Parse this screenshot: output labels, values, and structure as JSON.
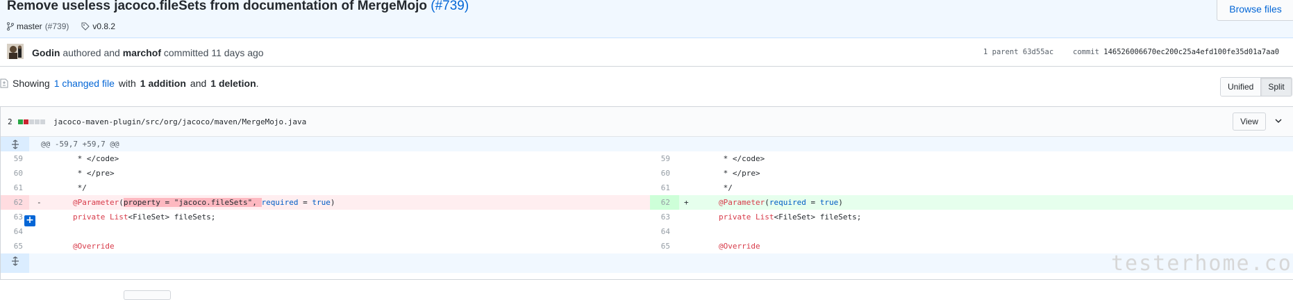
{
  "commit": {
    "title": "Remove useless jacoco.fileSets from documentation of MergeMojo",
    "pr_link": "(#739)",
    "branch": "master",
    "branch_pr": "(#739)",
    "tag": "v0.8.2",
    "browse_files": "Browse files"
  },
  "meta": {
    "author": "Godin",
    "authored_text": "authored and",
    "committer": "marchof",
    "committed_text": "committed 11 days ago",
    "parents_label": "1 parent",
    "parent_sha": "63d55ac",
    "commit_label": "commit",
    "commit_sha": "146526006670ec200c25a4efd100fe35d01a7aa0"
  },
  "toc": {
    "showing": "Showing",
    "changed": "1 changed file",
    "with": "with",
    "additions": "1 addition",
    "and": "and",
    "deletions": "1 deletion",
    "period": "."
  },
  "view_toggle": {
    "unified": "Unified",
    "split": "Split",
    "selected": "Split"
  },
  "file": {
    "changes": "2",
    "path": "jacoco-maven-plugin/src/org/jacoco/maven/MergeMojo.java",
    "view_button": "View",
    "diffstat": {
      "additions": 1,
      "deletions": 1,
      "neutral": 3
    }
  },
  "hunk": "@@ -59,7 +59,7 @@",
  "lines": [
    {
      "l_num": "59",
      "r_num": "59",
      "l_code": " * </code>",
      "r_code": " * </code>"
    },
    {
      "l_num": "60",
      "r_num": "60",
      "l_code": " * </pre>",
      "r_code": " * </pre>"
    },
    {
      "l_num": "61",
      "r_num": "61",
      "l_code": " */",
      "r_code": " */"
    },
    {
      "l_num": "62",
      "r_num": "62",
      "l_marker": "-",
      "r_marker": "+",
      "l_code_parts": [
        "@Parameter",
        "(",
        "property = \"jacoco.fileSets\", ",
        "required",
        " = ",
        "true",
        ")"
      ],
      "r_code_parts": [
        "@Parameter",
        "(",
        "required",
        " = ",
        "true",
        ")"
      ]
    },
    {
      "l_num": "63",
      "r_num": "63",
      "l_code_parts": [
        "private ",
        "List",
        "<",
        "FileSet",
        "> fileSets;"
      ],
      "r_code_parts": [
        "private ",
        "List",
        "<",
        "FileSet",
        "> fileSets;"
      ]
    },
    {
      "l_num": "64",
      "r_num": "64",
      "l_code": "",
      "r_code": ""
    },
    {
      "l_num": "65",
      "r_num": "65",
      "l_code": "@Override",
      "r_code": "@Override"
    }
  ],
  "watermark": "testerhome.com",
  "colors": {
    "link": "#0366d6",
    "deletion": "#cb2431",
    "addition": "#28a745",
    "neutral": "#d1d5da"
  },
  "icons": [
    "branch-icon",
    "tag-icon",
    "avatar",
    "file-diff-icon",
    "expand-icon",
    "chevron-down-icon",
    "plus-icon"
  ]
}
